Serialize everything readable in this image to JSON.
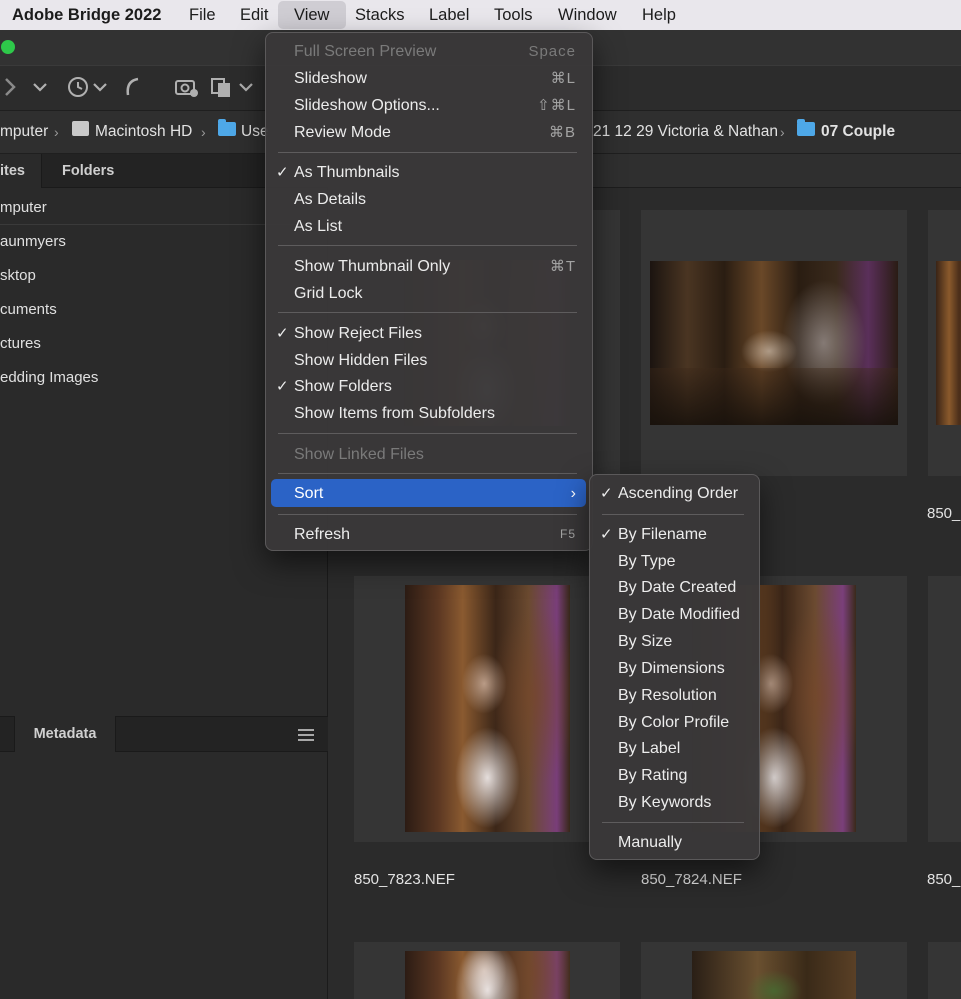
{
  "menubar": {
    "app_name": "Adobe Bridge 2022",
    "items": [
      "File",
      "Edit",
      "View",
      "Stacks",
      "Label",
      "Tools",
      "Window",
      "Help"
    ]
  },
  "pathbar": {
    "items": [
      "mputer",
      "Macintosh HD",
      "Use",
      "21 12 29 Victoria & Nathan",
      "07 Couple"
    ]
  },
  "left_panel": {
    "tabs": [
      "ites",
      "Folders"
    ],
    "favorites": [
      "mputer",
      "aunmyers",
      "sktop",
      "cuments",
      "ctures",
      "edding Images"
    ],
    "bottom_tab": "Metadata"
  },
  "content": {
    "filenames": [
      "850_",
      "850_7823.NEF",
      "850_7824.NEF",
      "850_"
    ]
  },
  "view_menu": {
    "items": [
      {
        "label": "Full Screen Preview",
        "shortcut": "Space",
        "disabled": true
      },
      {
        "label": "Slideshow",
        "shortcut": "⌘L"
      },
      {
        "label": "Slideshow Options...",
        "shortcut": "⇧⌘L"
      },
      {
        "label": "Review Mode",
        "shortcut": "⌘B"
      },
      {
        "label": "As Thumbnails",
        "checked": true
      },
      {
        "label": "As Details"
      },
      {
        "label": "As List"
      },
      {
        "label": "Show Thumbnail Only",
        "shortcut": "⌘T"
      },
      {
        "label": "Grid Lock"
      },
      {
        "label": "Show Reject Files",
        "checked": true
      },
      {
        "label": "Show Hidden Files"
      },
      {
        "label": "Show Folders",
        "checked": true
      },
      {
        "label": "Show Items from Subfolders"
      },
      {
        "label": "Show Linked Files",
        "disabled": true
      },
      {
        "label": "Sort",
        "highlighted": true
      },
      {
        "label": "Refresh",
        "shortcut": "F5"
      }
    ],
    "check_glyph": "✓",
    "submenu_glyph": "›"
  },
  "sort_submenu": {
    "items": [
      {
        "label": "Ascending Order",
        "checked": true
      },
      {
        "label": "By Filename",
        "checked": true
      },
      {
        "label": "By Type"
      },
      {
        "label": "By Date Created"
      },
      {
        "label": "By Date Modified"
      },
      {
        "label": "By Size"
      },
      {
        "label": "By Dimensions"
      },
      {
        "label": "By Resolution"
      },
      {
        "label": "By Color Profile"
      },
      {
        "label": "By Label"
      },
      {
        "label": "By Rating"
      },
      {
        "label": "By Keywords"
      },
      {
        "label": "Manually"
      }
    ]
  },
  "colors": {
    "menu_highlight": "#2b63c6",
    "folder_blue": "#4ea8e8",
    "window_green": "#2ec84a"
  }
}
